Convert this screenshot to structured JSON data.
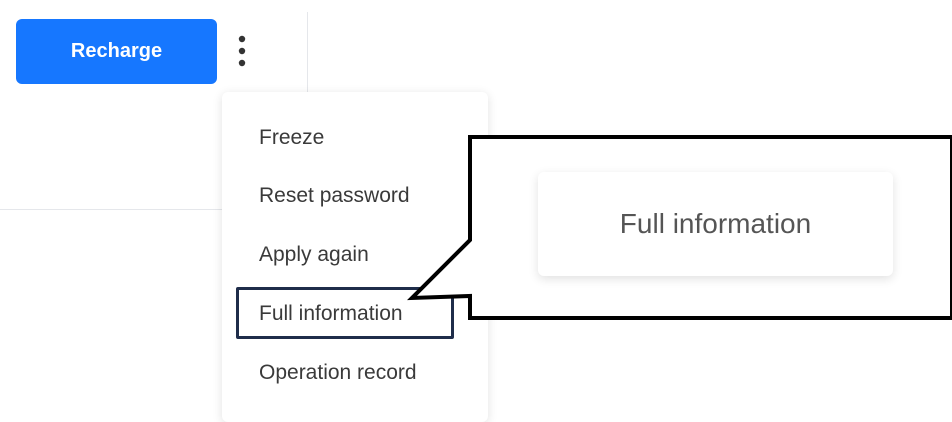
{
  "toolbar": {
    "recharge_label": "Recharge"
  },
  "dropdown": {
    "items": [
      {
        "label": "Freeze"
      },
      {
        "label": "Reset password"
      },
      {
        "label": "Apply again"
      },
      {
        "label": "Full information"
      },
      {
        "label": "Operation record"
      }
    ],
    "highlighted_index": 3
  },
  "callout": {
    "label": "Full information"
  },
  "colors": {
    "primary": "#1677ff",
    "highlight_border": "#1f2d4a"
  },
  "icons": {
    "more": "vertical-ellipsis-icon"
  }
}
